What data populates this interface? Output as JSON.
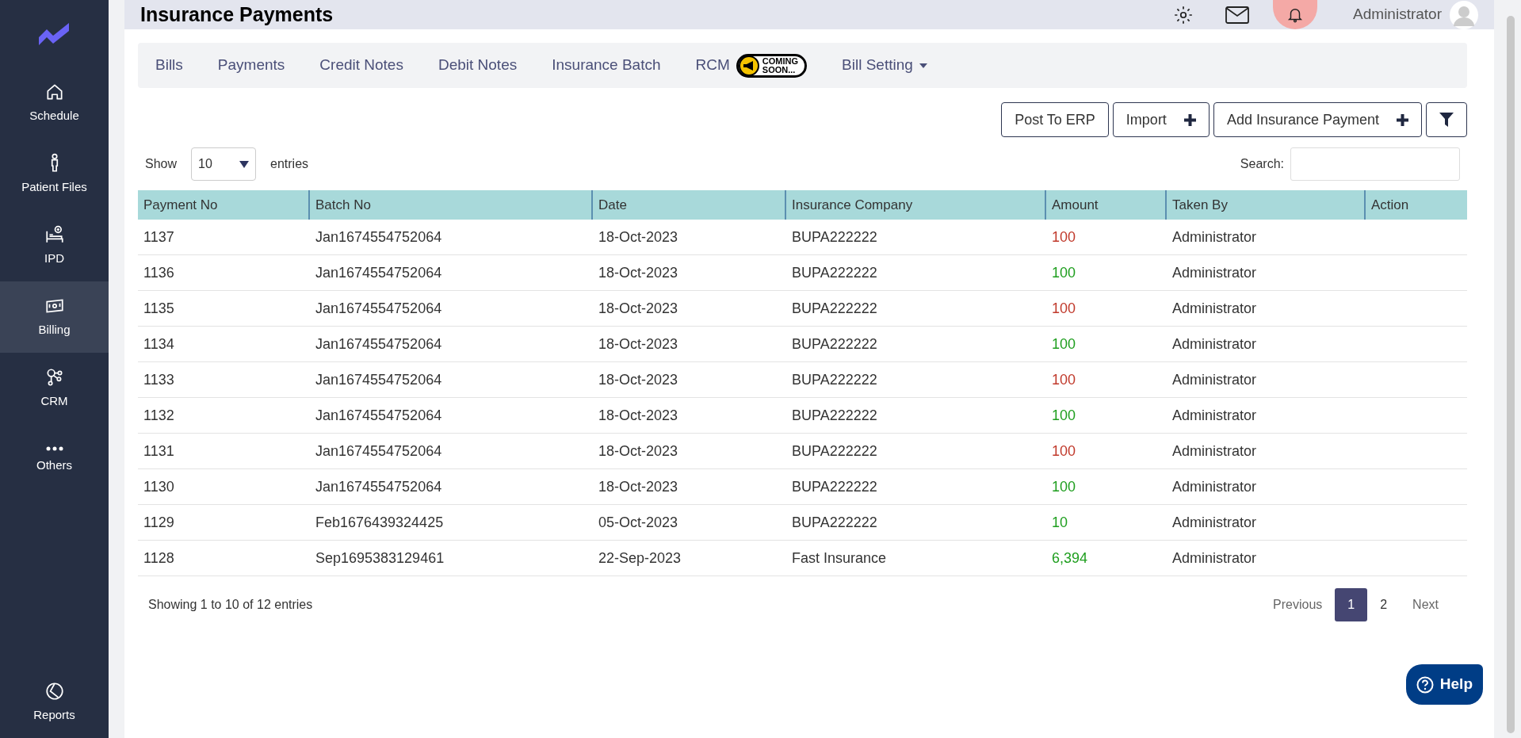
{
  "sidebar": {
    "items": [
      {
        "label": "Schedule",
        "kind": "home",
        "selected": false
      },
      {
        "label": "Patient Files",
        "kind": "person",
        "selected": false
      },
      {
        "label": "IPD",
        "kind": "bed",
        "selected": false
      },
      {
        "label": "Billing",
        "kind": "money",
        "selected": true
      },
      {
        "label": "CRM",
        "kind": "nodes",
        "selected": false
      },
      {
        "label": "Others",
        "kind": "dots",
        "selected": false
      }
    ],
    "bottom_item": {
      "label": "Reports",
      "kind": "pie",
      "selected": false
    }
  },
  "header": {
    "title": "Insurance Payments",
    "user": "Administrator"
  },
  "tabs": [
    {
      "label": "Bills",
      "selected": false
    },
    {
      "label": "Payments",
      "selected": false
    },
    {
      "label": "Credit Notes",
      "selected": false
    },
    {
      "label": "Debit Notes",
      "selected": false
    },
    {
      "label": "Insurance Batch",
      "selected": false
    },
    {
      "label": "RCM",
      "selected": false,
      "badge": [
        "COMING",
        "SOON..."
      ]
    },
    {
      "label": "Bill Setting",
      "selected": false,
      "dropdown": true
    }
  ],
  "actions": [
    {
      "label": "Post To ERP",
      "kind": "text"
    },
    {
      "label": "Import",
      "kind": "plus"
    },
    {
      "label": "Add Insurance Payment",
      "kind": "plus"
    },
    {
      "kind": "filter"
    }
  ],
  "show": {
    "label": "Show",
    "value": "10",
    "suffix": "entries"
  },
  "search": {
    "label": "Search:"
  },
  "table": {
    "columns": [
      "Payment No",
      "Batch No",
      "Date",
      "Insurance Company",
      "Amount",
      "Taken By",
      "Action"
    ],
    "rows": [
      {
        "payment_no": "1137",
        "batch_no": "Jan1674554752064",
        "date": "18-Oct-2023",
        "company": "BUPA222222",
        "amount": "100",
        "color": "#c0392b",
        "taken_by": "Administrator"
      },
      {
        "payment_no": "1136",
        "batch_no": "Jan1674554752064",
        "date": "18-Oct-2023",
        "company": "BUPA222222",
        "amount": "100",
        "color": "#1e9e1e",
        "taken_by": "Administrator"
      },
      {
        "payment_no": "1135",
        "batch_no": "Jan1674554752064",
        "date": "18-Oct-2023",
        "company": "BUPA222222",
        "amount": "100",
        "color": "#c0392b",
        "taken_by": "Administrator"
      },
      {
        "payment_no": "1134",
        "batch_no": "Jan1674554752064",
        "date": "18-Oct-2023",
        "company": "BUPA222222",
        "amount": "100",
        "color": "#1e9e1e",
        "taken_by": "Administrator"
      },
      {
        "payment_no": "1133",
        "batch_no": "Jan1674554752064",
        "date": "18-Oct-2023",
        "company": "BUPA222222",
        "amount": "100",
        "color": "#c0392b",
        "taken_by": "Administrator"
      },
      {
        "payment_no": "1132",
        "batch_no": "Jan1674554752064",
        "date": "18-Oct-2023",
        "company": "BUPA222222",
        "amount": "100",
        "color": "#1e9e1e",
        "taken_by": "Administrator"
      },
      {
        "payment_no": "1131",
        "batch_no": "Jan1674554752064",
        "date": "18-Oct-2023",
        "company": "BUPA222222",
        "amount": "100",
        "color": "#c0392b",
        "taken_by": "Administrator"
      },
      {
        "payment_no": "1130",
        "batch_no": "Jan1674554752064",
        "date": "18-Oct-2023",
        "company": "BUPA222222",
        "amount": "100",
        "color": "#1e9e1e",
        "taken_by": "Administrator"
      },
      {
        "payment_no": "1129",
        "batch_no": "Feb1676439324425",
        "date": "05-Oct-2023",
        "company": "BUPA222222",
        "amount": "10",
        "color": "#1e9e1e",
        "taken_by": "Administrator"
      },
      {
        "payment_no": "1128",
        "batch_no": "Sep1695383129461",
        "date": "22-Sep-2023",
        "company": "Fast Insurance",
        "amount": "6,394",
        "color": "#1e9e1e",
        "taken_by": "Administrator"
      }
    ]
  },
  "footer": {
    "info": "Showing 1 to 10 of 12 entries",
    "pagination": [
      {
        "label": "Previous",
        "kind": "nav",
        "selected": false
      },
      {
        "label": "1",
        "kind": "page",
        "selected": true
      },
      {
        "label": "2",
        "kind": "page",
        "selected": false
      },
      {
        "label": "Next",
        "kind": "nav",
        "selected": false
      }
    ]
  },
  "help": {
    "label": "Help"
  }
}
